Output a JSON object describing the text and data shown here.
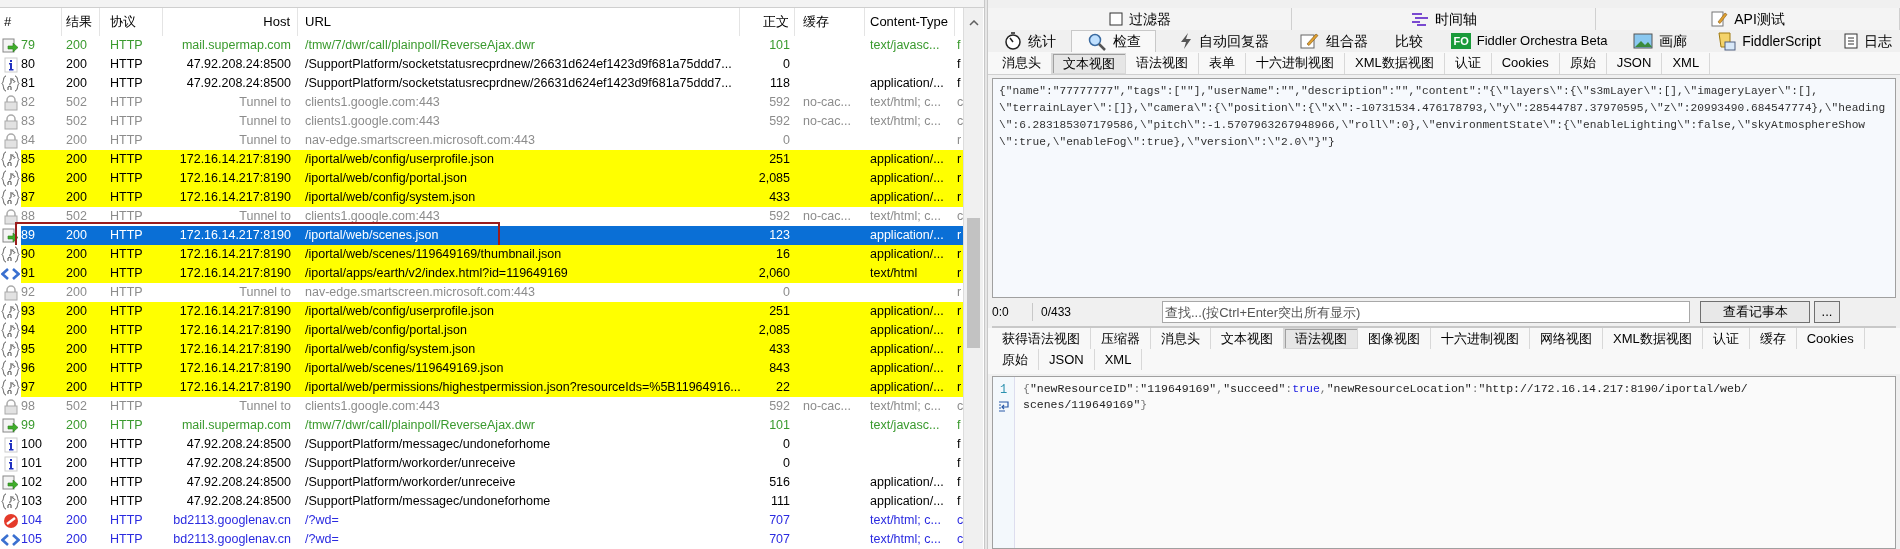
{
  "sessions": {
    "columns": [
      "#",
      "结果",
      "协议",
      "Host",
      "URL",
      "正文",
      "缓存",
      "Content-Type"
    ],
    "rows": [
      {
        "kind": "arrow",
        "number": "79",
        "result": "200",
        "protocol": "HTTP",
        "host": "mail.supermap.com",
        "url": "/tmw/7/dwr/call/plainpoll/ReverseAjax.dwr",
        "body": "101",
        "content_type": "text/javasc...",
        "column_9": "f",
        "color": "#3a9a2e",
        "highlight": false,
        "selected": false,
        "boxed": false
      },
      {
        "kind": "info",
        "number": "80",
        "result": "200",
        "protocol": "HTTP",
        "host": "47.92.208.24:8500",
        "url": "/SupportPlatform/socketstatusrecprdnew/26631d624ef1423d9f681a75ddd7...",
        "body": "0",
        "column_9": "f",
        "highlight": false,
        "selected": false,
        "boxed": false
      },
      {
        "kind": "json",
        "number": "81",
        "result": "200",
        "protocol": "HTTP",
        "host": "47.92.208.24:8500",
        "url": "/SupportPlatform/socketstatusrecprdnew/26631d624ef1423d9f681a75ddd7...",
        "body": "118",
        "content_type": "application/...",
        "column_9": "f",
        "highlight": false,
        "selected": false,
        "boxed": false
      },
      {
        "kind": "lock",
        "number": "82",
        "result": "502",
        "protocol": "HTTP",
        "host": "Tunnel to",
        "url": "clients1.google.com:443",
        "body": "592",
        "caching": "no-cac...",
        "content_type": "text/html; c...",
        "column_9": "c",
        "color": "#8c8c8c",
        "highlight": false,
        "selected": false,
        "boxed": false
      },
      {
        "kind": "lock",
        "number": "83",
        "result": "502",
        "protocol": "HTTP",
        "host": "Tunnel to",
        "url": "clients1.google.com:443",
        "body": "592",
        "caching": "no-cac...",
        "content_type": "text/html; c...",
        "column_9": "c",
        "color": "#8c8c8c",
        "highlight": false,
        "selected": false,
        "boxed": false
      },
      {
        "kind": "lock",
        "number": "84",
        "result": "200",
        "protocol": "HTTP",
        "host": "Tunnel to",
        "url": "nav-edge.smartscreen.microsoft.com:443",
        "body": "0",
        "column_9": "r",
        "color": "#8c8c8c",
        "highlight": false,
        "selected": false,
        "boxed": false
      },
      {
        "kind": "json",
        "number": "85",
        "result": "200",
        "protocol": "HTTP",
        "host": "172.16.14.217:8190",
        "url": "/iportal/web/config/userprofile.json",
        "body": "251",
        "content_type": "application/...",
        "column_9": "r",
        "highlight": true,
        "selected": false,
        "boxed": false
      },
      {
        "kind": "json",
        "number": "86",
        "result": "200",
        "protocol": "HTTP",
        "host": "172.16.14.217:8190",
        "url": "/iportal/web/config/portal.json",
        "body": "2,085",
        "content_type": "application/...",
        "column_9": "r",
        "highlight": true,
        "selected": false,
        "boxed": false
      },
      {
        "kind": "json",
        "number": "87",
        "result": "200",
        "protocol": "HTTP",
        "host": "172.16.14.217:8190",
        "url": "/iportal/web/config/system.json",
        "body": "433",
        "content_type": "application/...",
        "column_9": "r",
        "highlight": true,
        "selected": false,
        "boxed": false
      },
      {
        "kind": "lock",
        "number": "88",
        "result": "502",
        "protocol": "HTTP",
        "host": "Tunnel to",
        "url": "clients1.google.com:443",
        "body": "592",
        "caching": "no-cac...",
        "content_type": "text/html; c...",
        "column_9": "c",
        "color": "#8c8c8c",
        "highlight": false,
        "selected": false,
        "boxed": false
      },
      {
        "kind": "arrow",
        "number": "89",
        "result": "200",
        "protocol": "HTTP",
        "host": "172.16.14.217:8190",
        "url": "/iportal/web/scenes.json",
        "body": "123",
        "content_type": "application/...",
        "column_9": "r",
        "selected": true,
        "boxed": true
      },
      {
        "kind": "json",
        "number": "90",
        "result": "200",
        "protocol": "HTTP",
        "host": "172.16.14.217:8190",
        "url": "/iportal/web/scenes/119649169/thumbnail.json",
        "body": "16",
        "content_type": "application/...",
        "column_9": "r",
        "highlight": true,
        "selected": false,
        "boxed": false
      },
      {
        "kind": "html",
        "number": "91",
        "result": "200",
        "protocol": "HTTP",
        "host": "172.16.14.217:8190",
        "url": "/iportal/apps/earth/v2/index.html?id=119649169",
        "body": "2,060",
        "content_type": "text/html",
        "column_9": "r",
        "highlight": true,
        "selected": false,
        "boxed": false
      },
      {
        "kind": "lock",
        "number": "92",
        "result": "200",
        "protocol": "HTTP",
        "host": "Tunnel to",
        "url": "nav-edge.smartscreen.microsoft.com:443",
        "body": "0",
        "column_9": "r",
        "color": "#8c8c8c",
        "highlight": false,
        "selected": false,
        "boxed": false
      },
      {
        "kind": "json",
        "number": "93",
        "result": "200",
        "protocol": "HTTP",
        "host": "172.16.14.217:8190",
        "url": "/iportal/web/config/userprofile.json",
        "body": "251",
        "content_type": "application/...",
        "column_9": "r",
        "highlight": true,
        "selected": false,
        "boxed": false
      },
      {
        "kind": "json",
        "number": "94",
        "result": "200",
        "protocol": "HTTP",
        "host": "172.16.14.217:8190",
        "url": "/iportal/web/config/portal.json",
        "body": "2,085",
        "content_type": "application/...",
        "column_9": "r",
        "highlight": true,
        "selected": false,
        "boxed": false
      },
      {
        "kind": "json",
        "number": "95",
        "result": "200",
        "protocol": "HTTP",
        "host": "172.16.14.217:8190",
        "url": "/iportal/web/config/system.json",
        "body": "433",
        "content_type": "application/...",
        "column_9": "r",
        "highlight": true,
        "selected": false,
        "boxed": false
      },
      {
        "kind": "json",
        "number": "96",
        "result": "200",
        "protocol": "HTTP",
        "host": "172.16.14.217:8190",
        "url": "/iportal/web/scenes/119649169.json",
        "body": "843",
        "content_type": "application/...",
        "column_9": "r",
        "highlight": true,
        "selected": false,
        "boxed": false
      },
      {
        "kind": "json",
        "number": "97",
        "result": "200",
        "protocol": "HTTP",
        "host": "172.16.14.217:8190",
        "url": "/iportal/web/permissions/highestpermission.json?resourceIds=%5B11964916...",
        "body": "22",
        "content_type": "application/...",
        "column_9": "r",
        "highlight": true,
        "selected": false,
        "boxed": false
      },
      {
        "kind": "lock",
        "number": "98",
        "result": "502",
        "protocol": "HTTP",
        "host": "Tunnel to",
        "url": "clients1.google.com:443",
        "body": "592",
        "caching": "no-cac...",
        "content_type": "text/html; c...",
        "column_9": "c",
        "color": "#8c8c8c",
        "highlight": false,
        "selected": false,
        "boxed": false
      },
      {
        "kind": "arrow",
        "number": "99",
        "result": "200",
        "protocol": "HTTP",
        "host": "mail.supermap.com",
        "url": "/tmw/7/dwr/call/plainpoll/ReverseAjax.dwr",
        "body": "101",
        "content_type": "text/javasc...",
        "column_9": "f",
        "color": "#3a9a2e",
        "highlight": false,
        "selected": false,
        "boxed": false
      },
      {
        "kind": "info",
        "number": "100",
        "result": "200",
        "protocol": "HTTP",
        "host": "47.92.208.24:8500",
        "url": "/SupportPlatform/messagec/undoneforhome",
        "body": "0",
        "column_9": "f",
        "highlight": false,
        "selected": false,
        "boxed": false
      },
      {
        "kind": "info",
        "number": "101",
        "result": "200",
        "protocol": "HTTP",
        "host": "47.92.208.24:8500",
        "url": "/SupportPlatform/workorder/unreceive",
        "body": "0",
        "column_9": "f",
        "highlight": false,
        "selected": false,
        "boxed": false
      },
      {
        "kind": "arrow",
        "number": "102",
        "result": "200",
        "protocol": "HTTP",
        "host": "47.92.208.24:8500",
        "url": "/SupportPlatform/workorder/unreceive",
        "body": "516",
        "content_type": "application/...",
        "column_9": "f",
        "highlight": false,
        "selected": false,
        "boxed": false
      },
      {
        "kind": "json",
        "number": "103",
        "result": "200",
        "protocol": "HTTP",
        "host": "47.92.208.24:8500",
        "url": "/SupportPlatform/messagec/undoneforhome",
        "body": "111",
        "content_type": "application/...",
        "column_9": "f",
        "highlight": false,
        "selected": false,
        "boxed": false
      },
      {
        "kind": "blocked",
        "number": "104",
        "result": "200",
        "protocol": "HTTP",
        "host": "bd2113.googlenav.cn",
        "url": "/?wd=",
        "body": "707",
        "content_type": "text/html; c...",
        "column_9": "c",
        "color": "#2a2ae0",
        "highlight": false,
        "selected": false,
        "boxed": false
      },
      {
        "kind": "html",
        "number": "105",
        "result": "200",
        "protocol": "HTTP",
        "host": "bd2113.googlenav.cn",
        "url": "/?wd=",
        "body": "707",
        "content_type": "text/html; c...",
        "column_9": "c",
        "color": "#2a2ae0",
        "highlight": false,
        "selected": false,
        "boxed": false
      }
    ]
  },
  "top_tabs": [
    {
      "label": "过滤器",
      "kind": "checkbox",
      "checked": false
    },
    {
      "label": "时间轴",
      "kind": "timeline"
    },
    {
      "label": "API测试",
      "kind": "pencil"
    }
  ],
  "main_tabs": [
    {
      "label": "统计",
      "kind": "stopwatch",
      "selected": false
    },
    {
      "label": "检查",
      "kind": "magnifier",
      "selected": true
    },
    {
      "label": "自动回复器",
      "kind": "lightning",
      "selected": false
    },
    {
      "label": "组合器",
      "kind": "compose",
      "selected": false
    },
    {
      "label": "比较",
      "kind": "plain",
      "selected": false
    },
    {
      "label": "Fiddler Orchestra Beta",
      "kind": "badge",
      "badge": "FO",
      "selected": false
    },
    {
      "label": "画廊",
      "kind": "gallery",
      "selected": false
    },
    {
      "label": "FiddlerScript",
      "kind": "script",
      "selected": false
    },
    {
      "label": "日志",
      "kind": "log",
      "selected": false
    }
  ],
  "request": {
    "tabs": [
      {
        "label": "消息头",
        "selected": false
      },
      {
        "label": "文本视图",
        "selected": true
      },
      {
        "label": "语法视图",
        "selected": false
      },
      {
        "label": "表单",
        "selected": false
      },
      {
        "label": "十六进制视图",
        "selected": false
      },
      {
        "label": "XML数据视图",
        "selected": false
      },
      {
        "label": "认证",
        "selected": false
      },
      {
        "label": "Cookies",
        "selected": false
      },
      {
        "label": "原始",
        "selected": false
      },
      {
        "label": "JSON",
        "selected": false
      },
      {
        "label": "XML",
        "selected": false
      }
    ],
    "text_lines": [
      "{\"name\":\"77777777\",\"tags\":[\"\"],\"userName\":\"\",\"description\":\"\",\"content\":\"{\\\"layers\\\":{\\\"s3mLayer\\\":[],\\\"imageryLayer\\\":[],",
      "\\\"terrainLayer\\\":[]},\\\"camera\\\":{\\\"position\\\":{\\\"x\\\":-10731534.476178793,\\\"y\\\":28544787.37970595,\\\"z\\\":20993490.684547774},\\\"heading",
      "\\\":6.283185307179586,\\\"pitch\\\":-1.5707963267948966,\\\"roll\\\":0},\\\"environmentState\\\":{\\\"enableLighting\\\":false,\\\"skyAtmosphereShow",
      "\\\":true,\\\"enableFog\\\":true},\\\"version\\\":\\\"2.0\\\"}\"}"
    ],
    "caret_position": "0:0",
    "selection": "0/433",
    "find_placeholder": "查找...(按Ctrl+Enter突出所有显示)",
    "notepad_button": "查看记事本",
    "more_button": "..."
  },
  "response": {
    "tabs": [
      {
        "label": "获得语法视图",
        "selected": false
      },
      {
        "label": "压缩器",
        "selected": false
      },
      {
        "label": "消息头",
        "selected": false
      },
      {
        "label": "文本视图",
        "selected": false
      },
      {
        "label": "语法视图",
        "selected": true
      },
      {
        "label": "图像视图",
        "selected": false
      },
      {
        "label": "十六进制视图",
        "selected": false
      },
      {
        "label": "网络视图",
        "selected": false
      },
      {
        "label": "XML数据视图",
        "selected": false
      },
      {
        "label": "认证",
        "selected": false
      },
      {
        "label": "缓存",
        "selected": false
      },
      {
        "label": "Cookies",
        "selected": false
      },
      {
        "label": "原始",
        "selected": false
      },
      {
        "label": "JSON",
        "selected": false
      },
      {
        "label": "XML",
        "selected": false
      }
    ],
    "line_number": "1",
    "code_lines": [
      [
        {
          "text": "{",
          "kind": "punct"
        },
        {
          "text": "\"newResourceID\"",
          "kind": "string"
        },
        {
          "text": ":",
          "kind": "punct"
        },
        {
          "text": "\"119649169\"",
          "kind": "string"
        },
        {
          "text": ",",
          "kind": "punct"
        },
        {
          "text": "\"succeed\"",
          "kind": "string"
        },
        {
          "text": ":",
          "kind": "punct"
        },
        {
          "text": "true",
          "kind": "keyword"
        },
        {
          "text": ",",
          "kind": "punct"
        },
        {
          "text": "\"newResourceLocation\"",
          "kind": "string"
        },
        {
          "text": ":",
          "kind": "punct"
        },
        {
          "text": "\"http://172.16.14.217:8190/iportal/web/",
          "kind": "string"
        }
      ],
      [
        {
          "text": "scenes/119649169\"",
          "kind": "string"
        },
        {
          "text": "}",
          "kind": "punct"
        }
      ]
    ]
  }
}
